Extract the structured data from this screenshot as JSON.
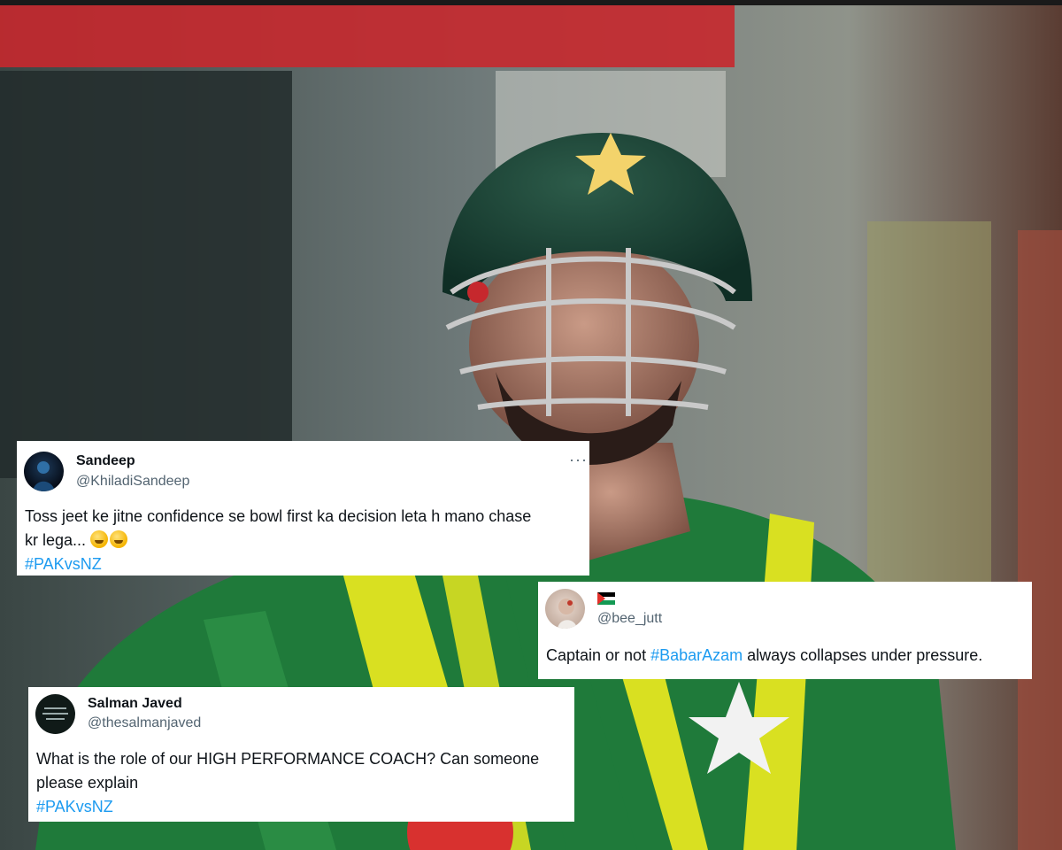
{
  "tweets": [
    {
      "name": "Sandeep",
      "handle": "@KhiladiSandeep",
      "text_line1": "Toss jeet ke jitne confidence se bowl first ka decision leta h  mano chase",
      "text_line2": "kr lega...",
      "hashtag": "#PAKvsNZ",
      "more_icon": "more-options-icon"
    },
    {
      "name": "",
      "handle": "@bee_jutt",
      "text_before": "Captain or not ",
      "hashtag": "#BabarAzam",
      "text_after": " always collapses under pressure.",
      "flag_icon": "palestine-flag-icon"
    },
    {
      "name": "Salman Javed",
      "handle": "@thesalmanjaved",
      "text_line1": "What is the role of our  HIGH PERFORMANCE COACH? Can someone",
      "text_line2": "please explain",
      "hashtag": "#PAKvsNZ"
    }
  ],
  "colors": {
    "hashtag": "#1d9bf0",
    "handle": "#536471",
    "jersey_green": "#1f7a3a",
    "jersey_yellow": "#d9e021"
  }
}
